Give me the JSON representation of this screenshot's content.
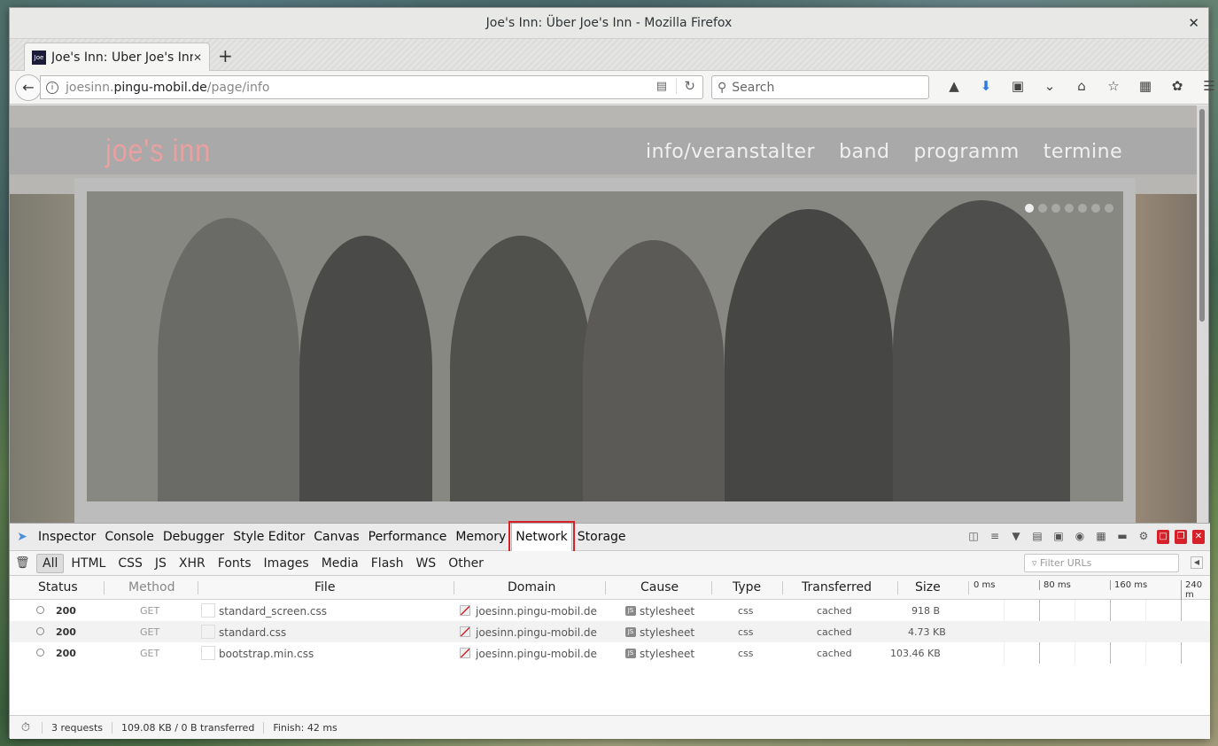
{
  "window": {
    "title": "Joe's Inn: Über Joe's Inn - Mozilla Firefox",
    "close_glyph": "✕"
  },
  "tab": {
    "favicon_text": "Joe",
    "label": "Joe's Inn: Über Joe's Inn",
    "close_glyph": "✕",
    "new_tab_glyph": "+"
  },
  "navbar": {
    "url_prefix": "joesinn.",
    "url_domain": "pingu-mobil.de",
    "url_path": "/page/info",
    "search_placeholder": "Search"
  },
  "site": {
    "logo": "joe's inn",
    "nav": [
      "info/veranstalter",
      "band",
      "programm",
      "termine"
    ],
    "slider_dots": 7
  },
  "devtools": {
    "tabs": [
      "Inspector",
      "Console",
      "Debugger",
      "Style Editor",
      "Canvas",
      "Performance",
      "Memory",
      "Network",
      "Storage"
    ],
    "selected_tab": "Network",
    "filters": [
      "All",
      "HTML",
      "CSS",
      "JS",
      "XHR",
      "Fonts",
      "Images",
      "Media",
      "Flash",
      "WS",
      "Other"
    ],
    "selected_filter": "All",
    "filter_placeholder": "Filter URLs",
    "columns": {
      "status": "Status",
      "method": "Method",
      "file": "File",
      "domain": "Domain",
      "cause": "Cause",
      "type": "Type",
      "transferred": "Transferred",
      "size": "Size"
    },
    "waterfall_ticks": [
      "0 ms",
      "80 ms",
      "160 ms",
      "240 m"
    ],
    "rows": [
      {
        "status": "200",
        "method": "GET",
        "file": "standard_screen.css",
        "domain": "joesinn.pingu-mobil.de",
        "cause": "stylesheet",
        "type": "css",
        "transferred": "cached",
        "size": "918 B"
      },
      {
        "status": "200",
        "method": "GET",
        "file": "standard.css",
        "domain": "joesinn.pingu-mobil.de",
        "cause": "stylesheet",
        "type": "css",
        "transferred": "cached",
        "size": "4.73 KB"
      },
      {
        "status": "200",
        "method": "GET",
        "file": "bootstrap.min.css",
        "domain": "joesinn.pingu-mobil.de",
        "cause": "stylesheet",
        "type": "css",
        "transferred": "cached",
        "size": "103.46 KB"
      }
    ],
    "footer": {
      "requests": "3 requests",
      "transferred": "109.08 KB / 0 B transferred",
      "finish": "Finish: 42 ms"
    }
  }
}
